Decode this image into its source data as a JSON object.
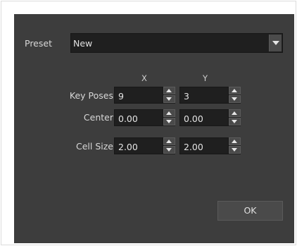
{
  "dialog": {
    "preset_label": "Preset",
    "preset_value": "New",
    "col_x": "X",
    "col_y": "Y",
    "rows": [
      {
        "label": "Key Poses",
        "x": "9",
        "y": "3"
      },
      {
        "label": "Center",
        "x": "0.00",
        "y": "0.00"
      },
      {
        "label": "Cell Size",
        "x": "2.00",
        "y": "2.00"
      }
    ],
    "ok_label": "OK"
  },
  "icons": {
    "dropdown": "chevron-down-icon",
    "spin_up": "spin-up-icon",
    "spin_down": "spin-down-icon"
  },
  "colors": {
    "dialog_bg": "#3d3d3d",
    "field_bg": "#1f1f1f",
    "button_bg": "#4a4a4a",
    "text": "#d8d8d8"
  }
}
